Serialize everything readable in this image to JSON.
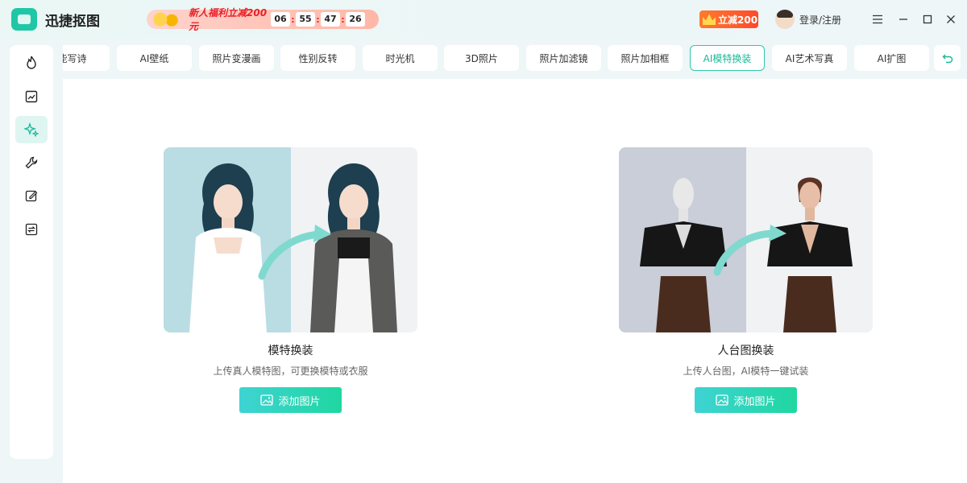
{
  "app": {
    "title": "迅捷抠图"
  },
  "promo": {
    "text": "新人福利立减200元",
    "countdown": [
      "06",
      "55",
      "47",
      "26"
    ]
  },
  "vip": {
    "label": "立减200"
  },
  "user": {
    "login_label": "登录/注册"
  },
  "tabs": [
    {
      "label": "能写诗"
    },
    {
      "label": "AI壁纸"
    },
    {
      "label": "照片变漫画"
    },
    {
      "label": "性别反转"
    },
    {
      "label": "时光机"
    },
    {
      "label": "3D照片"
    },
    {
      "label": "照片加滤镜"
    },
    {
      "label": "照片加相框"
    },
    {
      "label": "AI模特换装",
      "active": true
    },
    {
      "label": "AI艺术写真"
    },
    {
      "label": "AI扩图"
    }
  ],
  "sidebar": {
    "items": [
      {
        "icon": "flame-icon"
      },
      {
        "icon": "image-edit-icon"
      },
      {
        "icon": "sparkle-icon",
        "active": true
      },
      {
        "icon": "wrench-icon"
      },
      {
        "icon": "pencil-icon"
      },
      {
        "icon": "convert-icon"
      }
    ]
  },
  "cards": [
    {
      "title": "模特换装",
      "subtitle": "上传真人模特图，可更换模特或衣服",
      "button": "添加图片",
      "bg_left": "#b9dde3"
    },
    {
      "title": "人台图换装",
      "subtitle": "上传人台图，AI模特一键试装",
      "button": "添加图片",
      "bg_left": "#c9ced8"
    }
  ],
  "colors": {
    "accent": "#1fc7a6",
    "promo_red": "#e8202a",
    "vip_orange": "#ff5a2a"
  }
}
